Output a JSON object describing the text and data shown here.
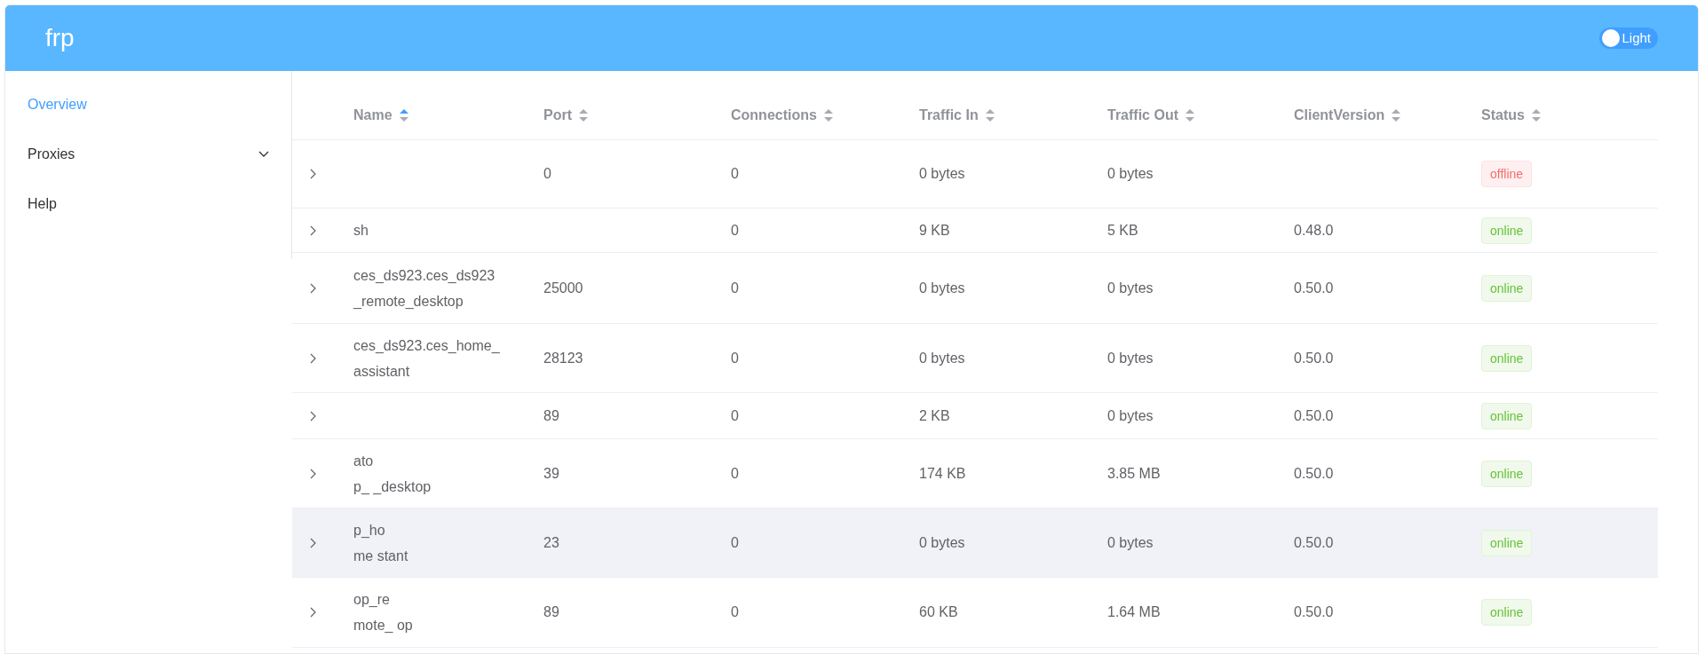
{
  "header": {
    "logo": "frp",
    "theme_switch": {
      "label": "Light",
      "on": false
    }
  },
  "sidebar": {
    "items": [
      {
        "label": "Overview",
        "selected": true,
        "expandable": false
      },
      {
        "label": "Proxies",
        "selected": false,
        "expandable": true
      },
      {
        "label": "Help",
        "selected": false,
        "expandable": false
      }
    ]
  },
  "table": {
    "columns": [
      {
        "label": "Name",
        "sorted": true
      },
      {
        "label": "Port",
        "sorted": false
      },
      {
        "label": "Connections",
        "sorted": false
      },
      {
        "label": "Traffic In",
        "sorted": false
      },
      {
        "label": "Traffic Out",
        "sorted": false
      },
      {
        "label": "ClientVersion",
        "sorted": false
      },
      {
        "label": "Status",
        "sorted": false
      }
    ],
    "rows": [
      {
        "name": [],
        "port": "0",
        "connections": "0",
        "traffic_in": "0 bytes",
        "traffic_out": "0 bytes",
        "client_version": "",
        "status": {
          "label": "offline",
          "kind": "offline"
        },
        "highlighted": false
      },
      {
        "name": [
          "sh"
        ],
        "port": "",
        "connections": "0",
        "traffic_in": "9 KB",
        "traffic_out": "5 KB",
        "client_version": "0.48.0",
        "status": {
          "label": "online",
          "kind": "online"
        },
        "highlighted": false
      },
      {
        "name": [
          "ces_ds923.ces_ds923",
          "_remote_desktop"
        ],
        "port": "25000",
        "connections": "0",
        "traffic_in": "0 bytes",
        "traffic_out": "0 bytes",
        "client_version": "0.50.0",
        "status": {
          "label": "online",
          "kind": "online"
        },
        "highlighted": false
      },
      {
        "name": [
          "ces_ds923.ces_home_",
          "assistant"
        ],
        "port": "28123",
        "connections": "0",
        "traffic_in": "0 bytes",
        "traffic_out": "0 bytes",
        "client_version": "0.50.0",
        "status": {
          "label": "online",
          "kind": "online"
        },
        "highlighted": false
      },
      {
        "name": [],
        "port": "89",
        "connections": "0",
        "traffic_in": "2 KB",
        "traffic_out": "0 bytes",
        "client_version": "0.50.0",
        "status": {
          "label": "online",
          "kind": "online"
        },
        "highlighted": false
      },
      {
        "name": [
          "ato",
          "p_ _desktop"
        ],
        "port": "39",
        "connections": "0",
        "traffic_in": "174 KB",
        "traffic_out": "3.85 MB",
        "client_version": "0.50.0",
        "status": {
          "label": "online",
          "kind": "online"
        },
        "highlighted": false
      },
      {
        "name": [
          "p_ho",
          "me stant"
        ],
        "port": "23",
        "connections": "0",
        "traffic_in": "0 bytes",
        "traffic_out": "0 bytes",
        "client_version": "0.50.0",
        "status": {
          "label": "online",
          "kind": "online"
        },
        "highlighted": true
      },
      {
        "name": [
          "op_re",
          "mote_ op"
        ],
        "port": "89",
        "connections": "0",
        "traffic_in": "60 KB",
        "traffic_out": "1.64 MB",
        "client_version": "0.50.0",
        "status": {
          "label": "online",
          "kind": "online"
        },
        "highlighted": false
      }
    ]
  }
}
